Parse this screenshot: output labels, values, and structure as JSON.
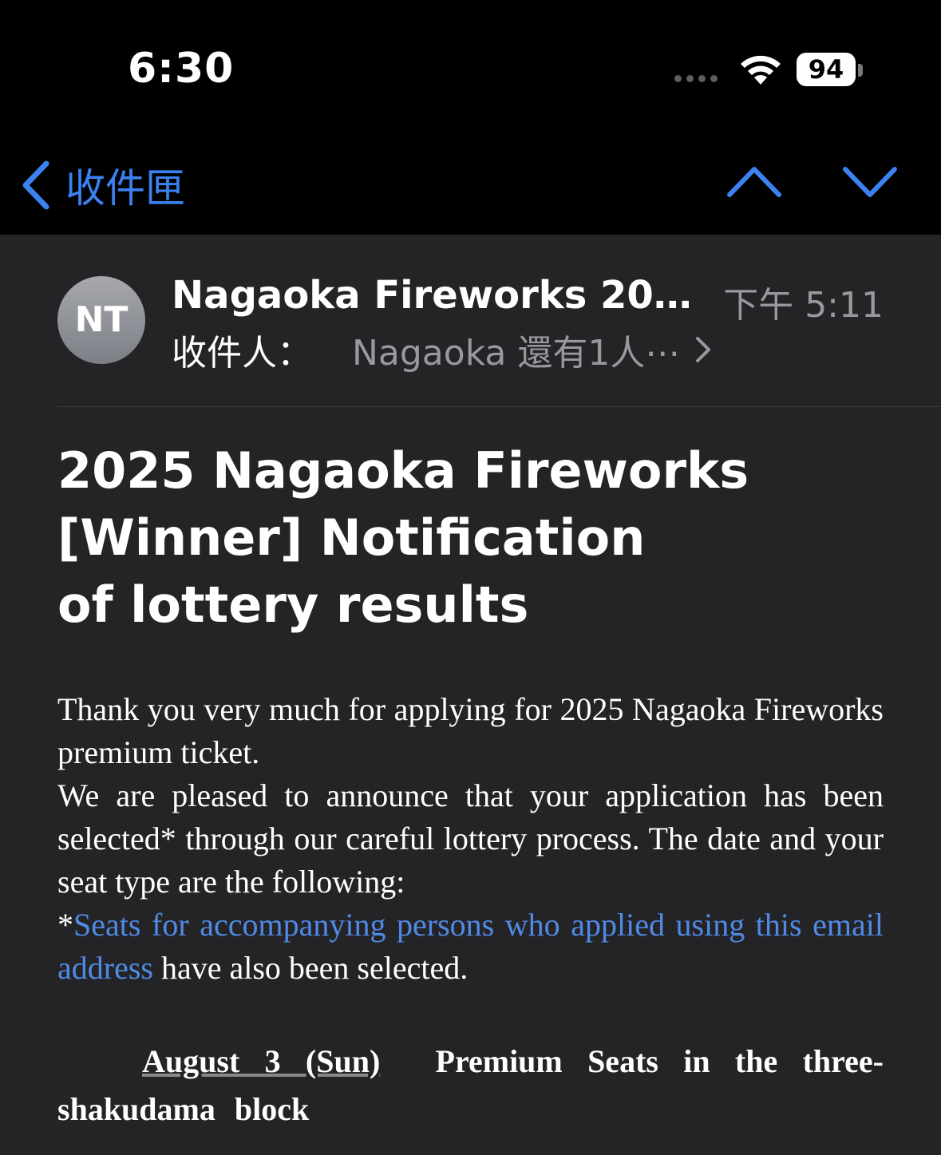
{
  "status_bar": {
    "time": "6:30",
    "battery": "94"
  },
  "nav": {
    "back_label": "收件匣",
    "icons": {
      "back": "chevron-left-icon",
      "prev": "chevron-up-icon",
      "next": "chevron-down-icon"
    },
    "accent_color": "#3b82f0"
  },
  "header": {
    "avatar_initials": "NT",
    "sender": "Nagaoka Fireworks 2025 I...",
    "time": "下午 5:11",
    "to_label": "收件人：",
    "to_value": "Nagaoka 還有1人⋯"
  },
  "subject": "2025 Nagaoka Fireworks\n[Winner] Notification\nof lottery results",
  "body": {
    "paragraph_1": "Thank you very much for applying for 2025 Nagaoka Fireworks premium ticket.",
    "paragraph_2": "We are pleased to announce that your application has been selected* through our careful lottery process. The date and your seat type are the following:",
    "note_prefix": "*",
    "note_link": "Seats for accompanying persons who applied using this email address",
    "note_suffix": " have also been selected.",
    "link_color": "#4f8ae6"
  },
  "schedule": {
    "date": "August 3 (Sun)",
    "seat": "Premium Seats in the three-shakudama block"
  }
}
